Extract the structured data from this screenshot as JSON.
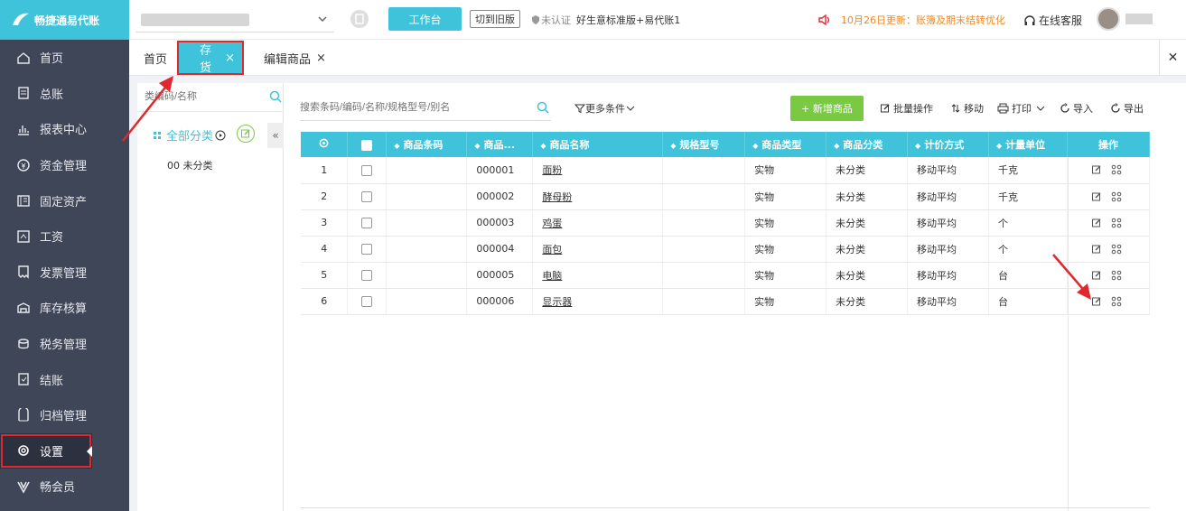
{
  "brand": {
    "name": "畅捷通易代账"
  },
  "menu": [
    {
      "label": "首页",
      "icon": "home-icon"
    },
    {
      "label": "总账",
      "icon": "ledger-icon"
    },
    {
      "label": "报表中心",
      "icon": "chart-icon"
    },
    {
      "label": "资金管理",
      "icon": "money-icon"
    },
    {
      "label": "固定资产",
      "icon": "asset-icon"
    },
    {
      "label": "工资",
      "icon": "salary-icon"
    },
    {
      "label": "发票管理",
      "icon": "invoice-icon"
    },
    {
      "label": "库存核算",
      "icon": "inventory-icon"
    },
    {
      "label": "税务管理",
      "icon": "tax-icon"
    },
    {
      "label": "结账",
      "icon": "closing-icon"
    },
    {
      "label": "归档管理",
      "icon": "archive-icon"
    },
    {
      "label": "设置",
      "icon": "gear-icon",
      "active": true
    },
    {
      "label": "畅会员",
      "icon": "vip-icon"
    }
  ],
  "topbar": {
    "workbench": "工作台",
    "old_version": "切到旧版",
    "cert_status": "未认证",
    "edition": "好生意标准版+易代账1",
    "notice": "10月26日更新：账簿及期末结转优化",
    "customer_service": "在线客服"
  },
  "tabs": {
    "home": "首页",
    "inventory": "存货",
    "edit": "编辑商品"
  },
  "left": {
    "search_placeholder": "类编码/名称",
    "all_category": "全部分类",
    "uncategorized": "00 未分类"
  },
  "main": {
    "search_placeholder": "搜索条码/编码/名称/规格型号/别名",
    "more_conditions": "更多条件",
    "add_button": "+ 新增商品",
    "batch": "批量操作",
    "move": "移动",
    "print": "打印",
    "import": "导入",
    "export": "导出"
  },
  "table": {
    "columns": [
      "商品条码",
      "商品...",
      "商品名称",
      "规格型号",
      "商品类型",
      "商品分类",
      "计价方式",
      "计量单位"
    ],
    "ops_header": "操作",
    "rows": [
      {
        "no": "1",
        "code": "000001",
        "name": "面粉",
        "type": "实物",
        "cat": "未分类",
        "method": "移动平均",
        "unit": "千克"
      },
      {
        "no": "2",
        "code": "000002",
        "name": "酵母粉",
        "type": "实物",
        "cat": "未分类",
        "method": "移动平均",
        "unit": "千克"
      },
      {
        "no": "3",
        "code": "000003",
        "name": "鸡蛋",
        "type": "实物",
        "cat": "未分类",
        "method": "移动平均",
        "unit": "个"
      },
      {
        "no": "4",
        "code": "000004",
        "name": "面包",
        "type": "实物",
        "cat": "未分类",
        "method": "移动平均",
        "unit": "个"
      },
      {
        "no": "5",
        "code": "000005",
        "name": "电脑",
        "type": "实物",
        "cat": "未分类",
        "method": "移动平均",
        "unit": "台"
      },
      {
        "no": "6",
        "code": "000006",
        "name": "显示器",
        "type": "实物",
        "cat": "未分类",
        "method": "移动平均",
        "unit": "台"
      }
    ]
  },
  "colors": {
    "accent": "#3fc3da",
    "sidebar": "#3f4657",
    "green": "#7ac943",
    "highlight": "#e0282f",
    "notice": "#f08a24"
  }
}
